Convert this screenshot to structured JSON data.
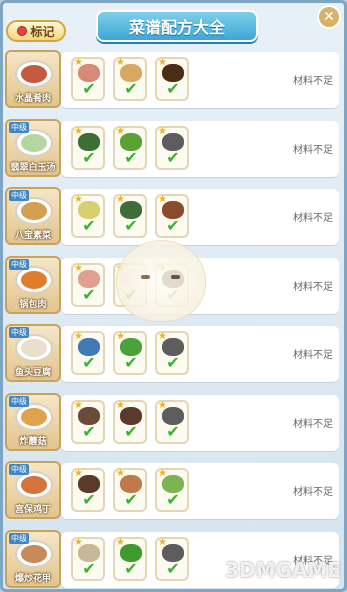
{
  "header": {
    "tag_label": "标记",
    "title": "菜谱配方大全",
    "close_symbol": "✕"
  },
  "colors": {
    "title_bg": "#3da6d6",
    "check_green": "#37b52d",
    "star_gold": "#f2b41d"
  },
  "recipes": [
    {
      "name": "水晶肴肉",
      "badge": "",
      "status": "材料不足",
      "food_color": "#c65a3e",
      "ingredients": [
        {
          "icon": "pork-belly-icon",
          "color": "#d78a7a"
        },
        {
          "icon": "ginger-icon",
          "color": "#d9a860"
        },
        {
          "icon": "soy-sauce-icon",
          "color": "#4a2c17"
        }
      ]
    },
    {
      "name": "翡翠白玉汤",
      "badge": "中级",
      "status": "材料不足",
      "food_color": "#b5d6a2",
      "ingredients": [
        {
          "icon": "cabbage-icon",
          "color": "#3f6d36"
        },
        {
          "icon": "green-pepper-icon",
          "color": "#5aa234"
        },
        {
          "icon": "tofu-icon",
          "color": "#5d5d5d"
        }
      ]
    },
    {
      "name": "八宝素菜",
      "badge": "中级",
      "status": "材料不足",
      "food_color": "#d4a050",
      "ingredients": [
        {
          "icon": "bamboo-shoot-icon",
          "color": "#d8cf6e"
        },
        {
          "icon": "cabbage-icon",
          "color": "#3f6d36"
        },
        {
          "icon": "mushroom-icon",
          "color": "#8a4a2c"
        }
      ]
    },
    {
      "name": "锅包肉",
      "badge": "中级",
      "status": "材料不足",
      "food_color": "#e07d2c",
      "ingredients": [
        {
          "icon": "pork-icon",
          "color": "#e0a090"
        },
        {
          "icon": "flour-icon",
          "color": "#eaeaea"
        },
        {
          "icon": "vinegar-icon",
          "color": "#3a2a20"
        }
      ]
    },
    {
      "name": "鱼头豆腐",
      "badge": "中级",
      "status": "材料不足",
      "food_color": "#e8e0cc",
      "ingredients": [
        {
          "icon": "fish-icon",
          "color": "#3f7ab5"
        },
        {
          "icon": "coriander-icon",
          "color": "#4ca23a"
        },
        {
          "icon": "tofu-icon",
          "color": "#5d5d5d"
        }
      ]
    },
    {
      "name": "炸蘑菇",
      "badge": "中级",
      "status": "材料不足",
      "food_color": "#e0a24a",
      "ingredients": [
        {
          "icon": "mushroom-icon",
          "color": "#6b4a3a"
        },
        {
          "icon": "meat-icon",
          "color": "#5a3a2a"
        },
        {
          "icon": "tofu-icon",
          "color": "#5d5d5d"
        }
      ]
    },
    {
      "name": "宫保鸡丁",
      "badge": "中级",
      "status": "材料不足",
      "food_color": "#d4743a",
      "ingredients": [
        {
          "icon": "chicken-icon",
          "color": "#5a3b2a"
        },
        {
          "icon": "peanut-icon",
          "color": "#c07a4a"
        },
        {
          "icon": "scallion-icon",
          "color": "#7ab552"
        }
      ]
    },
    {
      "name": "爆炒花甲",
      "badge": "中级",
      "status": "材料不足",
      "food_color": "#c78a5a",
      "ingredients": [
        {
          "icon": "clam-icon",
          "color": "#c8b89a"
        },
        {
          "icon": "green-pepper-icon",
          "color": "#3f9b2e"
        },
        {
          "icon": "tofu-icon",
          "color": "#5d5d5d"
        }
      ]
    }
  ],
  "check_symbol": "✔",
  "star_symbol": "★",
  "watermark": "3DMGAME"
}
